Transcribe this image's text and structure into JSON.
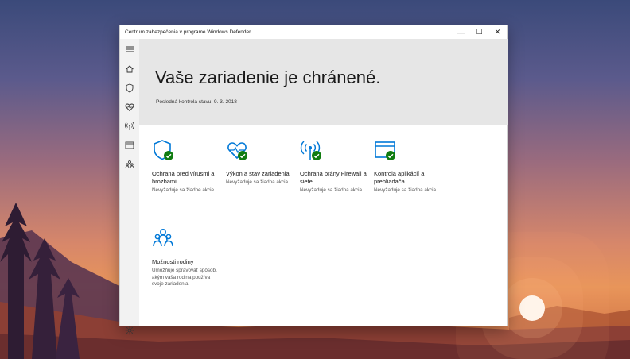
{
  "window": {
    "title": "Centrum zabezpečenia v programe Windows Defender",
    "controls": {
      "minimize": "—",
      "maximize": "☐",
      "close": "✕"
    }
  },
  "sidebar": {
    "items": [
      {
        "icon": "hamburger-menu-icon"
      },
      {
        "icon": "home-icon"
      },
      {
        "icon": "shield-icon"
      },
      {
        "icon": "heart-health-icon"
      },
      {
        "icon": "wireless-firewall-icon"
      },
      {
        "icon": "app-browser-icon"
      },
      {
        "icon": "family-icon"
      },
      {
        "icon": "settings-gear-icon"
      }
    ]
  },
  "hero": {
    "heading": "Vaše zariadenie je chránené.",
    "last_check": "Posledná kontrola stavu: 9. 3. 2018"
  },
  "tiles": [
    {
      "name": "Ochrana pred vírusmi a hrozbami",
      "desc": "Nevyžaduje sa žiadne akcie.",
      "icon": "shield-check-icon"
    },
    {
      "name": "Výkon a stav zariadenia",
      "desc": "Nevyžaduje sa žiadna akcia.",
      "icon": "heart-check-icon"
    },
    {
      "name": "Ochrana brány Firewall a siete",
      "desc": "Nevyžaduje sa žiadna akcia.",
      "icon": "wireless-check-icon"
    },
    {
      "name": "Kontrola aplikácií a prehliadača",
      "desc": "Nevyžaduje sa žiadna akcia.",
      "icon": "app-browser-check-icon"
    },
    {
      "name": "Možnosti rodiny",
      "desc": "Umožňuje spravovať spôsob, akým vaša rodina používa svoje zariadenia.",
      "icon": "family-icon"
    }
  ],
  "colors": {
    "accent": "#0078d7",
    "check": "#107c10",
    "hero_bg": "#e6e6e6",
    "sidebar_bg": "#f2f2f2"
  }
}
